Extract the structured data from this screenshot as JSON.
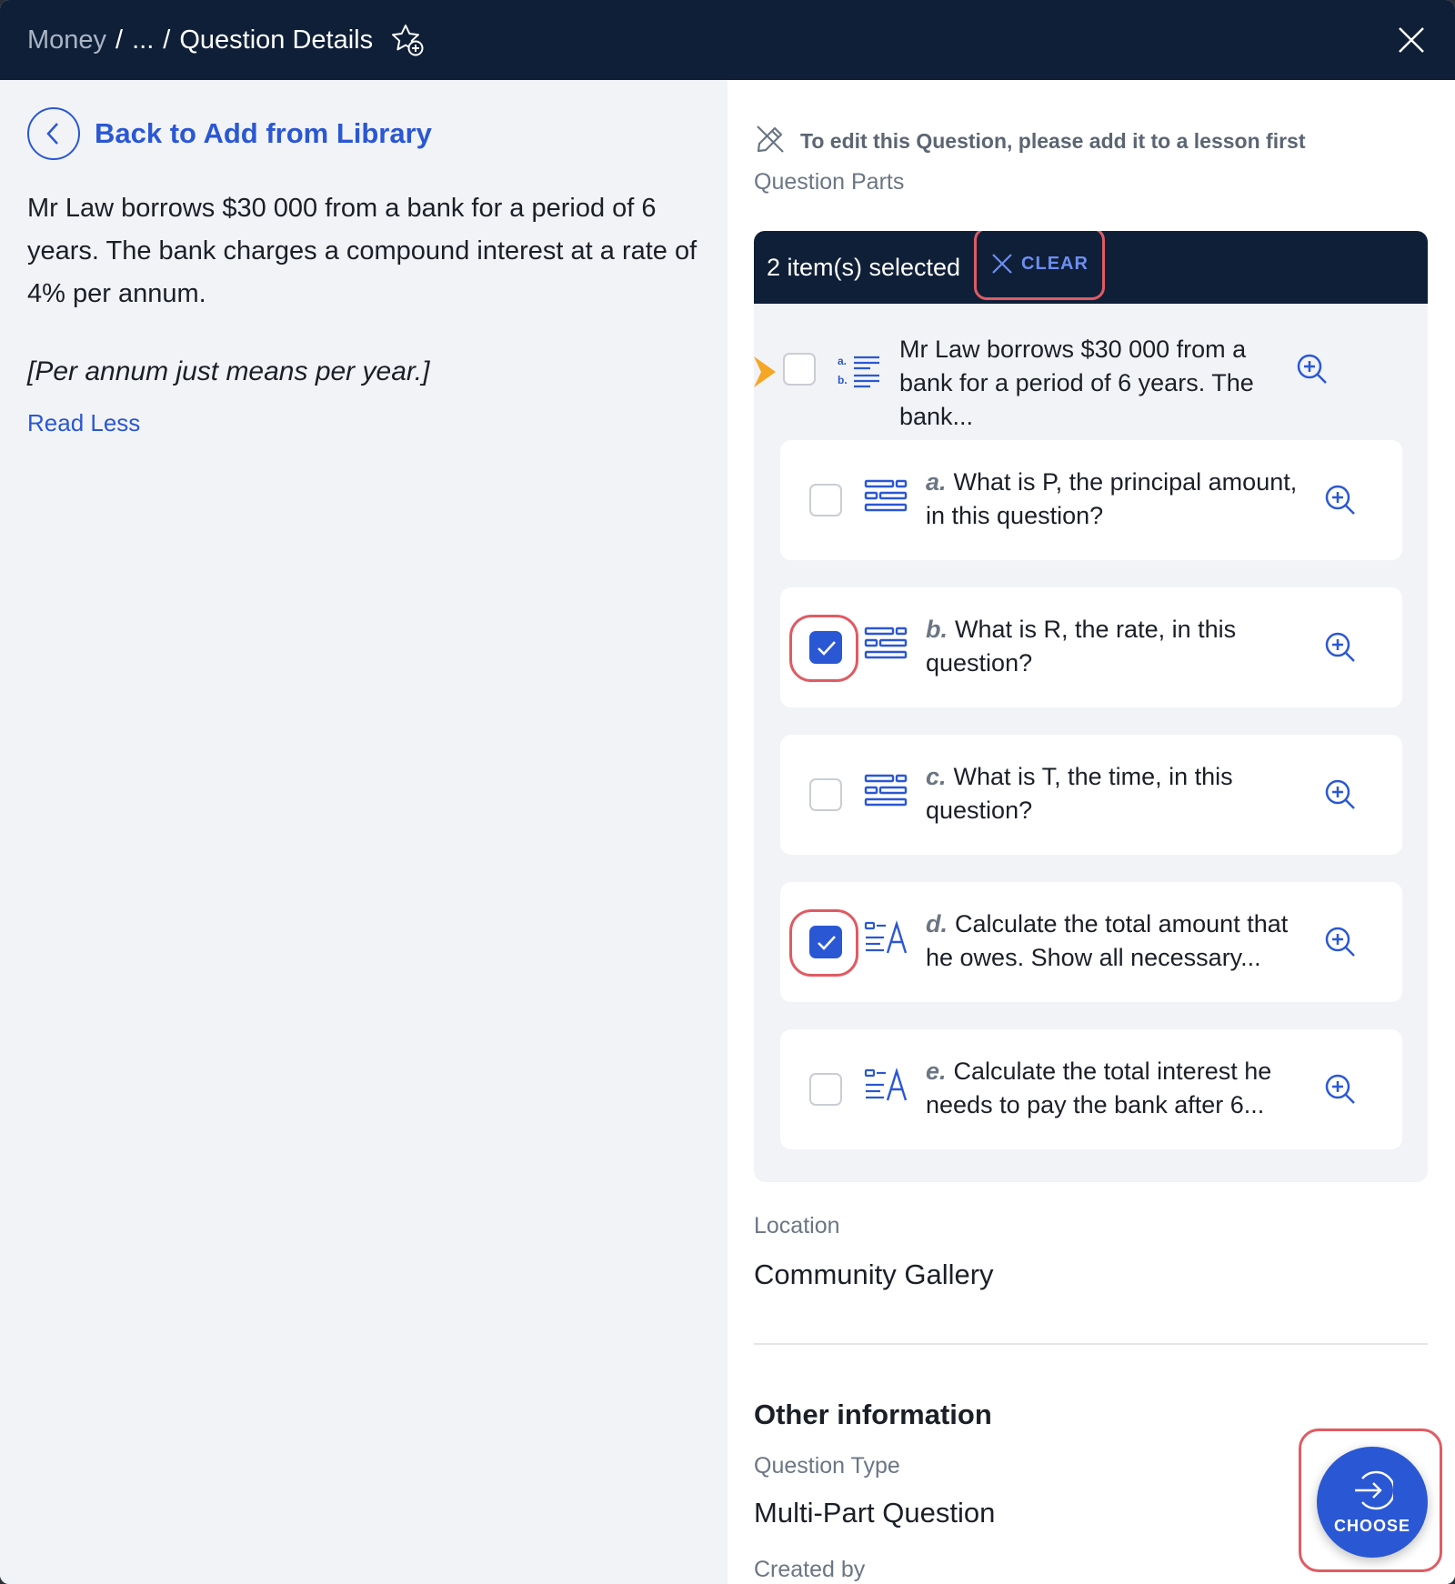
{
  "header": {
    "crumb_root": "Money",
    "crumb_sep1": "/",
    "crumb_ellipsis": "...",
    "crumb_sep2": "/",
    "crumb_current": "Question Details"
  },
  "left": {
    "back_label": "Back to Add from Library",
    "question_text": "Mr Law borrows $30 000 from a bank for a period of 6 years. The bank charges a compound interest at a rate of 4% per annum.",
    "note": "[Per annum just means per year.]",
    "read_less": "Read Less"
  },
  "right": {
    "edit_note": "To edit this Question, please add it to a lesson first",
    "parts_label": "Question Parts",
    "selected_text": "2 item(s) selected",
    "clear_label": "CLEAR",
    "main_part": {
      "title": "Mr Law borrows $30 000 from a bank for a period of 6 years. The bank...",
      "checked": false
    },
    "parts": [
      {
        "letter": "a.",
        "text": "What is P, the principal amount, in this question?",
        "checked": false,
        "icon": "short-answer-icon"
      },
      {
        "letter": "b.",
        "text": "What is R, the rate, in this question?",
        "checked": true,
        "icon": "short-answer-icon"
      },
      {
        "letter": "c.",
        "text": "What is T, the time, in this question?",
        "checked": false,
        "icon": "short-answer-icon"
      },
      {
        "letter": "d.",
        "text": "Calculate the total amount that he owes. Show all necessary...",
        "checked": true,
        "icon": "long-answer-icon"
      },
      {
        "letter": "e.",
        "text": "Calculate the total interest he needs to pay the bank after 6...",
        "checked": false,
        "icon": "long-answer-icon"
      }
    ],
    "location_label": "Location",
    "location_value": "Community Gallery",
    "other_title": "Other information",
    "qtype_label": "Question Type",
    "qtype_value": "Multi-Part Question",
    "created_label": "Created by",
    "choose_label": "CHOOSE"
  },
  "colors": {
    "header_bg": "#0f1f38",
    "accent": "#2a57d4",
    "highlight": "#e05b63",
    "marker": "#f5a623"
  }
}
